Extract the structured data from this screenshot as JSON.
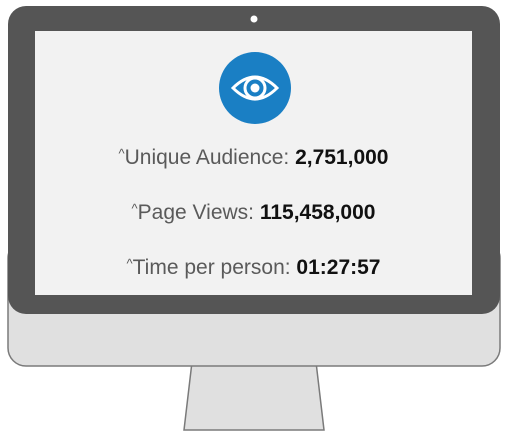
{
  "colors": {
    "bezel": "#555555",
    "frame": "#e0e0e0",
    "screen": "#f2f2f2",
    "accent": "#1a7fc4",
    "label_text": "#5a5a5a",
    "value_text": "#111111"
  },
  "icon": "eye-icon",
  "stats": [
    {
      "caret": "^",
      "label": "Unique Audience: ",
      "value": "2,751,000"
    },
    {
      "caret": "^",
      "label": "Page Views: ",
      "value": "115,458,000"
    },
    {
      "caret": "^",
      "label": "Time per person: ",
      "value": "01:27:57"
    }
  ]
}
